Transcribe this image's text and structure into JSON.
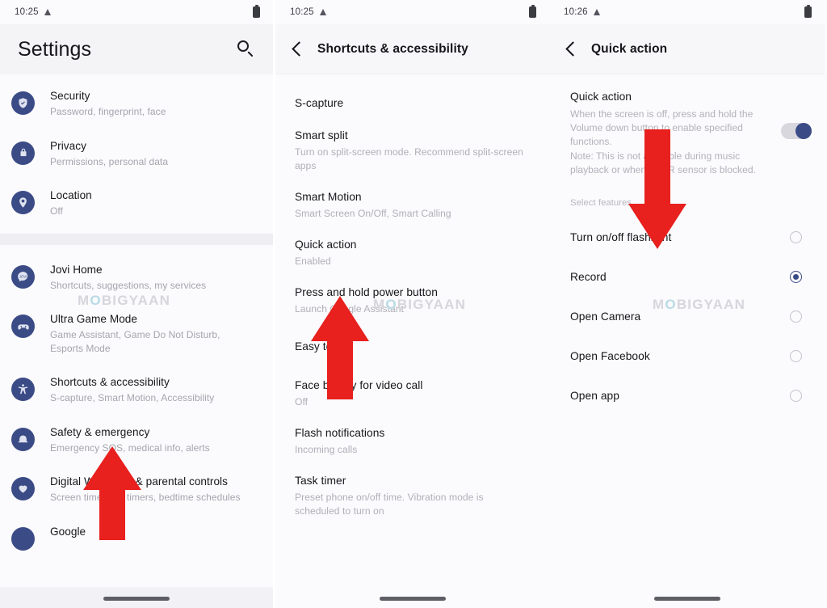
{
  "watermark": {
    "pre": "M",
    "o": "O",
    "post": "BIGYAAN"
  },
  "panel1": {
    "statusbar": {
      "time": "10:25",
      "signal_icon": "triangle-signal-icon",
      "battery_icon": "battery-icon"
    },
    "header": {
      "title": "Settings",
      "search_icon": "search-icon"
    },
    "items": [
      {
        "icon": "shield-check-icon",
        "title": "Security",
        "subtitle": "Password, fingerprint, face"
      },
      {
        "icon": "lock-icon",
        "title": "Privacy",
        "subtitle": "Permissions, personal data"
      },
      {
        "icon": "location-pin-icon",
        "title": "Location",
        "subtitle": "Off"
      }
    ],
    "items2": [
      {
        "icon": "jovi-icon",
        "title": "Jovi Home",
        "subtitle": "Shortcuts, suggestions, my services"
      },
      {
        "icon": "gamepad-icon",
        "title": "Ultra Game Mode",
        "subtitle": "Game Assistant, Game Do Not Disturb, Esports Mode"
      },
      {
        "icon": "accessibility-icon",
        "title": "Shortcuts & accessibility",
        "subtitle": "S-capture, Smart Motion, Accessibility"
      },
      {
        "icon": "emergency-bell-icon",
        "title": "Safety & emergency",
        "subtitle": "Emergency SOS, medical info, alerts"
      },
      {
        "icon": "heart-icon",
        "title": "Digital Wellbeing & parental controls",
        "subtitle": "Screen time, app timers, bedtime schedules"
      },
      {
        "icon": "google-icon",
        "title": "Google",
        "subtitle": ""
      }
    ]
  },
  "panel2": {
    "statusbar": {
      "time": "10:25",
      "signal_icon": "triangle-signal-icon",
      "battery_icon": "battery-icon"
    },
    "header": {
      "back_icon": "back-chevron-icon",
      "title": "Shortcuts & accessibility"
    },
    "items": [
      {
        "title": "S-capture",
        "subtitle": ""
      },
      {
        "title": "Smart split",
        "subtitle": "Turn on split-screen mode. Recommend split-screen apps"
      },
      {
        "title": "Smart Motion",
        "subtitle": "Smart Screen On/Off, Smart Calling"
      },
      {
        "title": "Quick action",
        "subtitle": "Enabled"
      },
      {
        "title": "Press and hold power button",
        "subtitle": "Launch Google Assistant"
      },
      {
        "title": "Easy touch",
        "subtitle": ""
      },
      {
        "title": "Face beauty for video call",
        "subtitle": "Off"
      },
      {
        "title": "Flash notifications",
        "subtitle": "Incoming calls"
      },
      {
        "title": "Task timer",
        "subtitle": "Preset phone on/off time. Vibration mode is scheduled to turn on"
      }
    ]
  },
  "panel3": {
    "statusbar": {
      "time": "10:26",
      "signal_icon": "triangle-signal-icon",
      "battery_icon": "battery-icon"
    },
    "header": {
      "back_icon": "back-chevron-icon",
      "title": "Quick action"
    },
    "quick_action": {
      "title": "Quick action",
      "description": "When the screen is off, press and hold the Volume down button to enable specified functions.\nNote: This is not available during music playback or when the IR sensor is blocked.",
      "toggle_state": "on"
    },
    "section_label": "Select features",
    "options": [
      {
        "label": "Turn on/off flashlight",
        "selected": false
      },
      {
        "label": "Record",
        "selected": true
      },
      {
        "label": "Open Camera",
        "selected": false
      },
      {
        "label": "Open Facebook",
        "selected": false
      },
      {
        "label": "Open app",
        "selected": false
      }
    ]
  },
  "colors": {
    "accent": "#3a4b86",
    "arrow": "#e8201e",
    "background": "#fbfafc",
    "header_bg": "#f4f3f6"
  }
}
